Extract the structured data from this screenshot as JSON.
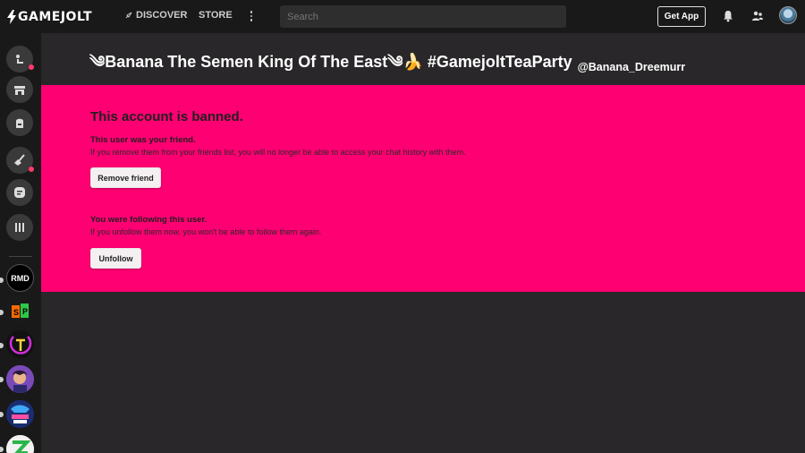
{
  "topbar": {
    "logo_game": "GAME",
    "logo_jolt": "JOLT",
    "discover_label": "DISCOVER",
    "store_label": "STORE",
    "search_placeholder": "Search",
    "get_app_label": "Get App",
    "icons": [
      "more-vertical-icon",
      "bell-icon",
      "friends-icon",
      "user-avatar"
    ]
  },
  "sidebar": {
    "items": [
      {
        "name": "activity",
        "icon": "activity-icon",
        "badge": true
      },
      {
        "name": "store",
        "icon": "store-icon",
        "badge": false
      },
      {
        "name": "library",
        "icon": "backpack-icon",
        "badge": false
      },
      {
        "name": "discover",
        "icon": "broom-icon",
        "badge": true
      },
      {
        "name": "chat",
        "icon": "chat-icon",
        "badge": false
      },
      {
        "name": "collections",
        "icon": "collections-icon",
        "badge": false
      }
    ],
    "communities": [
      {
        "name": "community-rmd",
        "label": "RMD"
      },
      {
        "name": "community-sp",
        "label": "SP"
      },
      {
        "name": "community-ti",
        "label": "T"
      },
      {
        "name": "community-character",
        "label": ""
      },
      {
        "name": "community-fnf",
        "label": ""
      },
      {
        "name": "community-z",
        "label": ""
      }
    ]
  },
  "profile": {
    "display_name": "༄Banana The Semen King Of The East༄🍌 #GamejoltTeaParty",
    "username": "@Banana_Dreemurr"
  },
  "banned": {
    "title": "This account is banned.",
    "friend_heading": "This user was your friend.",
    "friend_text": "If you remove them from your friends list, you will no longer be able to access your chat history with them.",
    "remove_friend_label": "Remove friend",
    "follow_heading": "You were following this user.",
    "follow_text": "If you unfollow them now, you won't be able to follow them again.",
    "unfollow_label": "Unfollow"
  },
  "colors": {
    "accent": "#ff0073",
    "topbar_bg": "#191919",
    "page_bg": "#292729"
  }
}
